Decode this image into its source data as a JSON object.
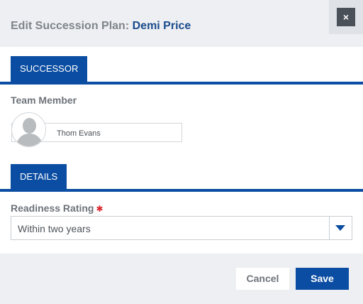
{
  "dialog": {
    "title_prefix": "Edit Succession Plan:",
    "title_name": "Demi Price",
    "close_label": "×"
  },
  "successor_section": {
    "tab_label": "SUCCESSOR",
    "team_member_label": "Team Member",
    "team_member_value": "Thom Evans"
  },
  "details_section": {
    "tab_label": "DETAILS",
    "readiness_label": "Readiness Rating",
    "required_marker": "✱",
    "readiness_value": "Within two years"
  },
  "footer": {
    "cancel_label": "Cancel",
    "save_label": "Save"
  },
  "colors": {
    "accent": "#0b4da2",
    "required": "#d9252c",
    "header_bg": "#eeeff2"
  }
}
